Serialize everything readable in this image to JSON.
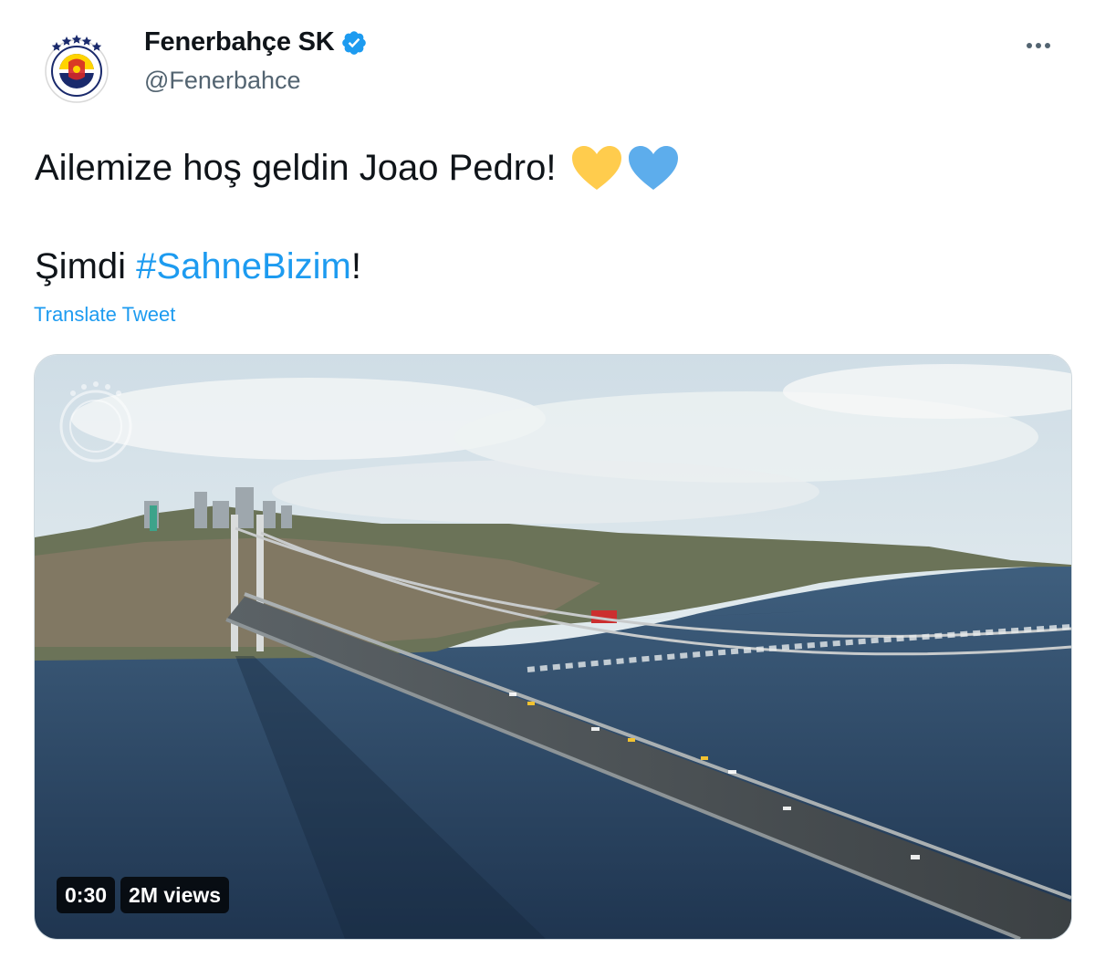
{
  "tweet": {
    "author": {
      "display_name": "Fenerbahçe SK",
      "handle": "@Fenerbahce",
      "verified": true,
      "avatar_icon": "fenerbahce-crest"
    },
    "text_line1": "Ailemize hoş geldin Joao Pedro!",
    "emojis": [
      "yellow-heart",
      "blue-heart"
    ],
    "text_line2_prefix": "Şimdi ",
    "hashtag": "#SahneBizim",
    "text_line2_suffix": "!",
    "translate_label": "Translate Tweet",
    "media": {
      "type": "video",
      "duration": "0:30",
      "views": "2M views"
    }
  },
  "colors": {
    "link": "#1d9bf0",
    "text": "#0f1419",
    "secondary": "#536471",
    "heart_yellow": "#ffcc4d",
    "heart_blue": "#5dadec",
    "verified": "#1d9bf0"
  }
}
